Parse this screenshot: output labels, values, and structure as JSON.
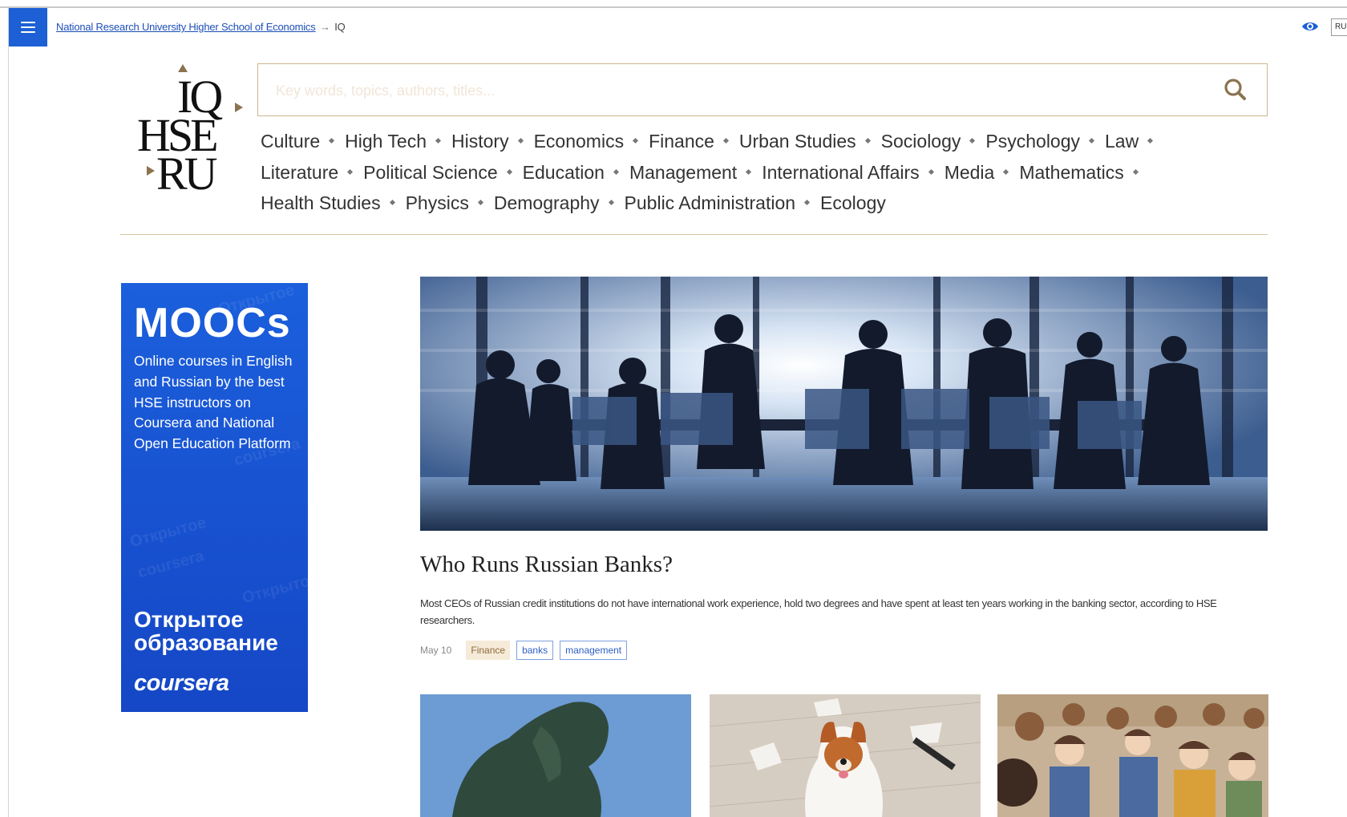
{
  "breadcrumb": {
    "parent": "National Research University Higher School of Economics",
    "separator": "→",
    "current": "IQ"
  },
  "header": {
    "lang_button": "RU"
  },
  "logo": {
    "line1": "IQ",
    "line2": "HSE",
    "line3": "RU"
  },
  "search": {
    "placeholder": "Key words, topics, authors, titles..."
  },
  "topics": [
    "Culture",
    "High Tech",
    "History",
    "Economics",
    "Finance",
    "Urban Studies",
    "Sociology",
    "Psychology",
    "Law",
    "Literature",
    "Political Science",
    "Education",
    "Management",
    "International Affairs",
    "Media",
    "Mathematics",
    "Health Studies",
    "Physics",
    "Demography",
    "Public Administration",
    "Ecology"
  ],
  "mooc_banner": {
    "title": "MOOCs",
    "text": "Online courses in English and Russian by the best HSE instructors on Coursera and National Open Education Platform",
    "brand": "Открытое образование",
    "partner": "coursera"
  },
  "featured_article": {
    "title": "Who Runs Russian Banks?",
    "description": "Most CEOs of Russian credit institutions do not have international work experience, hold two degrees and have spent at least ten years working in the banking sector, according to HSE researchers.",
    "date": "May 10",
    "category": "Finance",
    "tags": [
      "banks",
      "management"
    ]
  },
  "colors": {
    "accent_blue": "#1d60d5",
    "gold_border": "#cdb58f",
    "tag_blue": "#2d5fc4",
    "finance_tag_bg": "#f6ebd8"
  }
}
